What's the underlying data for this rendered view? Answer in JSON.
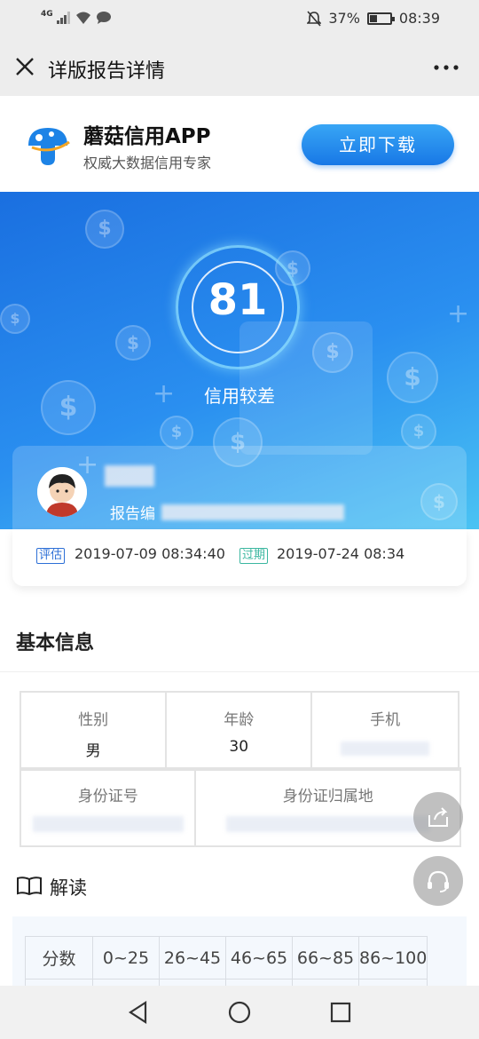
{
  "status_bar": {
    "network": "4G",
    "battery_percent": "37%",
    "battery_level": 0.37,
    "time": "08:39"
  },
  "title_bar": {
    "title": "详版报告详情",
    "close_icon": "close-icon",
    "more_icon": "more-icon"
  },
  "app_banner": {
    "name": "蘑菇信用APP",
    "subtitle": "权威大数据信用专家",
    "download_label": "立即下载",
    "colors": {
      "button": "#1e88ea"
    }
  },
  "hero": {
    "score": "81",
    "level": "信用较差",
    "report_label": "报告编",
    "colors": {
      "background": "#2a8ff0"
    }
  },
  "dates": {
    "eval_tag": "评估",
    "eval_time": "2019-07-09 08:34:40",
    "expire_tag": "过期",
    "expire_time": "2019-07-24 08:34",
    "colors": {
      "eval": "#2d6fd6",
      "expire": "#3bb7a0"
    }
  },
  "basic_info": {
    "title": "基本信息",
    "gender_label": "性别",
    "gender_value": "男",
    "age_label": "年龄",
    "age_value": "30",
    "phone_label": "手机",
    "id_label": "身份证号",
    "id_location_label": "身份证归属地"
  },
  "interpretation": {
    "title": "解读",
    "headers": [
      "分数",
      "0~25",
      "26~45",
      "46~65",
      "66~85",
      "86~100"
    ]
  },
  "floating": {
    "share_icon": "share-icon",
    "service_icon": "headset-icon"
  },
  "nav": {
    "back_icon": "back-triangle-icon",
    "home_icon": "home-circle-icon",
    "recent_icon": "recent-square-icon"
  }
}
